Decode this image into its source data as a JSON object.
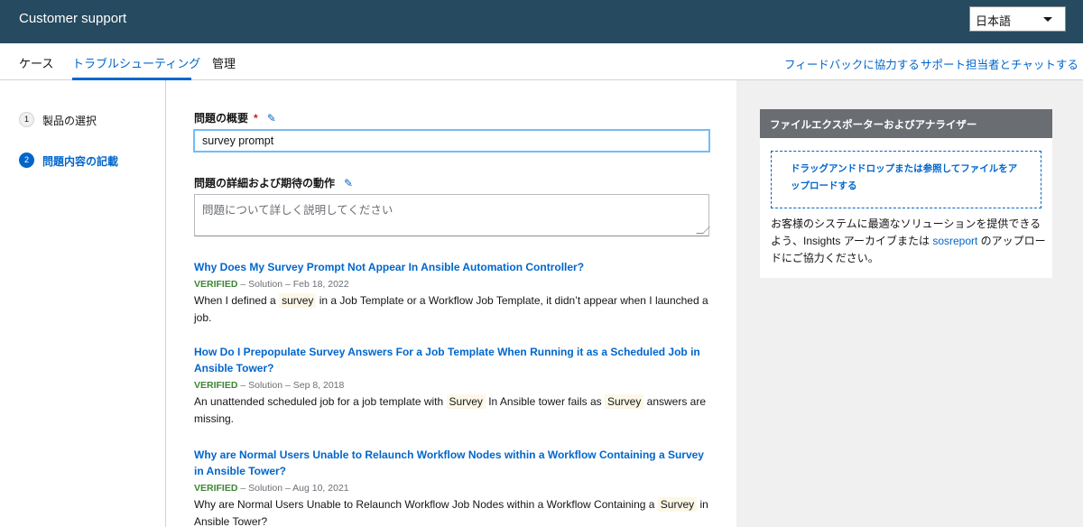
{
  "header": {
    "title": "Customer support",
    "language": "日本語"
  },
  "tabs": [
    {
      "label": "ケース"
    },
    {
      "label": "トラブルシューティング"
    },
    {
      "label": "管理"
    }
  ],
  "top_links": {
    "feedback": "フィードバックに協力する",
    "chat": "サポート担当者とチャットする"
  },
  "steps": [
    {
      "num": "1",
      "label": "製品の選択"
    },
    {
      "num": "2",
      "label": "問題内容の記載"
    }
  ],
  "form": {
    "summary_label": "問題の概要",
    "required_mark": "*",
    "summary_value": "survey prompt",
    "details_label": "問題の詳細および期待の動作",
    "details_placeholder": "問題について詳しく説明してください"
  },
  "results": [
    {
      "title": "Why Does My Survey Prompt Not Appear In Ansible Automation Controller?",
      "verified": "VERIFIED",
      "meta": " – Solution – Feb 18, 2022",
      "desc_a": "When I defined a ",
      "highlight": "survey",
      "desc_b": " in a Job Template or a Workflow Job Template, it didn’t appear when I launched a job."
    },
    {
      "title": "How Do I Prepopulate Survey Answers For a Job Template When Running it as a Scheduled Job in Ansible Tower?",
      "verified": "VERIFIED",
      "meta": " – Solution – Sep 8, 2018",
      "desc_a": "An unattended scheduled job for a job template with ",
      "highlight": "Survey",
      "desc_b": " In Ansible tower fails as ",
      "highlight2": "Survey",
      "desc_c": " answers are missing."
    },
    {
      "title": "Why are Normal Users Unable to Relaunch Workflow Nodes within a Workflow Containing a Survey in Ansible Tower?",
      "verified": "VERIFIED",
      "meta": " – Solution – Aug 10, 2021",
      "desc_a": "Why are Normal Users Unable to Relaunch Workflow Job Nodes within a Workflow Containing a ",
      "highlight": "Survey",
      "desc_b": " in Ansible Tower?"
    }
  ],
  "side_card": {
    "header": "ファイルエクスポーターおよびアナライザー",
    "dropzone": "ドラッグアンドドロップまたは参照してファイルをアップロードする",
    "body_a": "お客様のシステムに最適なソリューションを提供できるよう、Insights アーカイブまたは ",
    "body_link": "sosreport",
    "body_b": " のアップロードにご協力ください。"
  },
  "colors": {
    "header_bg": "#264a60",
    "accent": "#06c",
    "verified": "#3e8635",
    "required": "#c9190b"
  },
  "icons": {
    "edit": "pencil-icon",
    "select": "caret-down-icon"
  }
}
